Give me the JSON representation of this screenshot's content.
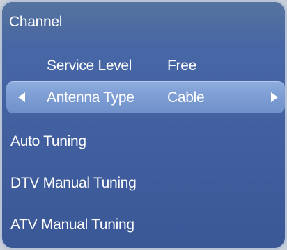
{
  "panel": {
    "title": "Channel"
  },
  "settings": {
    "service_level": {
      "label": "Service Level",
      "value": "Free"
    },
    "antenna_type": {
      "label": "Antenna Type",
      "value": "Cable"
    }
  },
  "menu": {
    "items": [
      {
        "label": "Auto Tuning"
      },
      {
        "label": "DTV Manual Tuning"
      },
      {
        "label": "ATV Manual Tuning"
      }
    ]
  },
  "icons": {
    "left": "arrow-left-icon",
    "right": "arrow-right-icon"
  },
  "colors": {
    "panel_background": "#4564a4",
    "highlight": "#7e9ed4",
    "text": "#ffffff"
  }
}
